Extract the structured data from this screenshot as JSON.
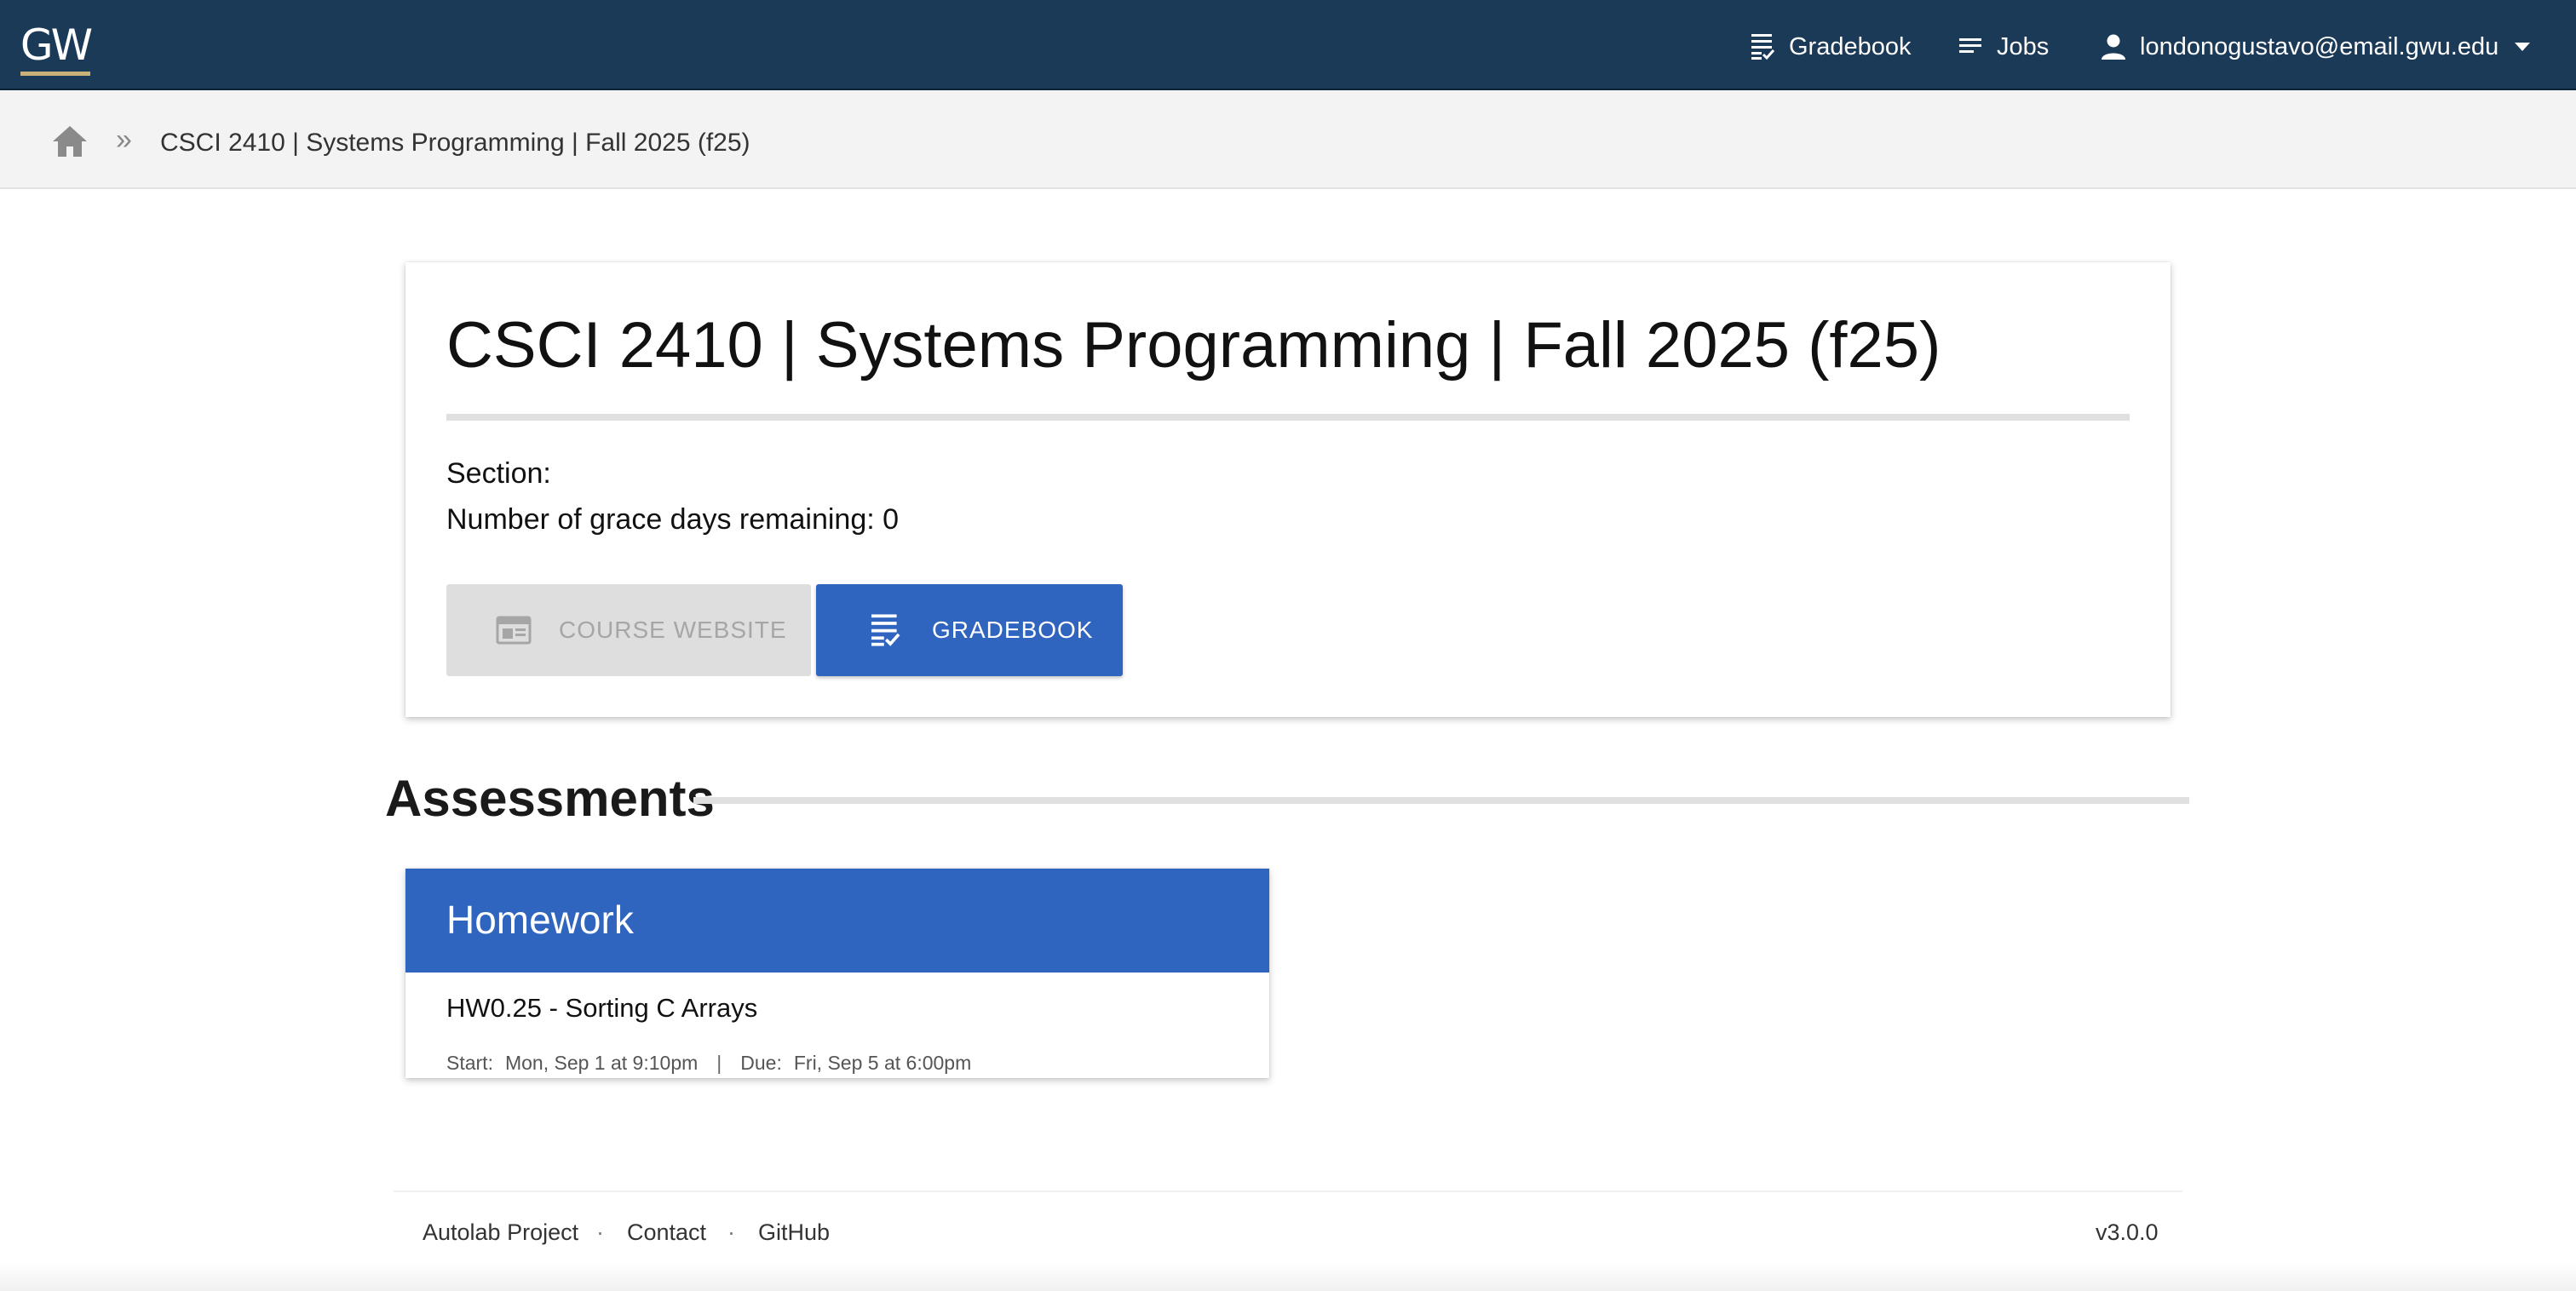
{
  "navbar": {
    "logo_text": "GW",
    "gradebook_label": "Gradebook",
    "jobs_label": "Jobs",
    "user_email": "londonogustavo@email.gwu.edu"
  },
  "breadcrumb": {
    "separator": "»",
    "current": "CSCI 2410 | Systems Programming | Fall 2025 (f25)"
  },
  "course": {
    "title": "CSCI 2410 | Systems Programming | Fall 2025 (f25)",
    "section_label": "Section:",
    "grace_days_label": "Number of grace days remaining: 0",
    "course_website_button": "COURSE WEBSITE",
    "gradebook_button": "GRADEBOOK"
  },
  "assessments": {
    "heading": "Assessments",
    "categories": [
      {
        "name": "Homework",
        "items": [
          {
            "name": "HW0.25 - Sorting C Arrays",
            "start_label": "Start:",
            "start": "Mon, Sep 1 at 9:10pm",
            "due_label": "Due:",
            "due": "Fri, Sep 5 at 6:00pm"
          }
        ]
      }
    ]
  },
  "footer": {
    "autolab_link": "Autolab Project",
    "contact_link": "Contact",
    "github_link": "GitHub",
    "dot": "·",
    "version": "v3.0.0"
  },
  "colors": {
    "navbar_bg": "#1b3a57",
    "accent_blue": "#2f64bf",
    "logo_gold": "#c8b27a",
    "breadcrumb_bg": "#f4f3f4",
    "disabled_button_bg": "#dedede"
  },
  "icons": {
    "gradebook": "gradebook-icon",
    "jobs": "jobs-icon",
    "user": "person-icon",
    "caret": "caret-down-icon",
    "home": "home-icon",
    "website": "web-window-icon"
  }
}
